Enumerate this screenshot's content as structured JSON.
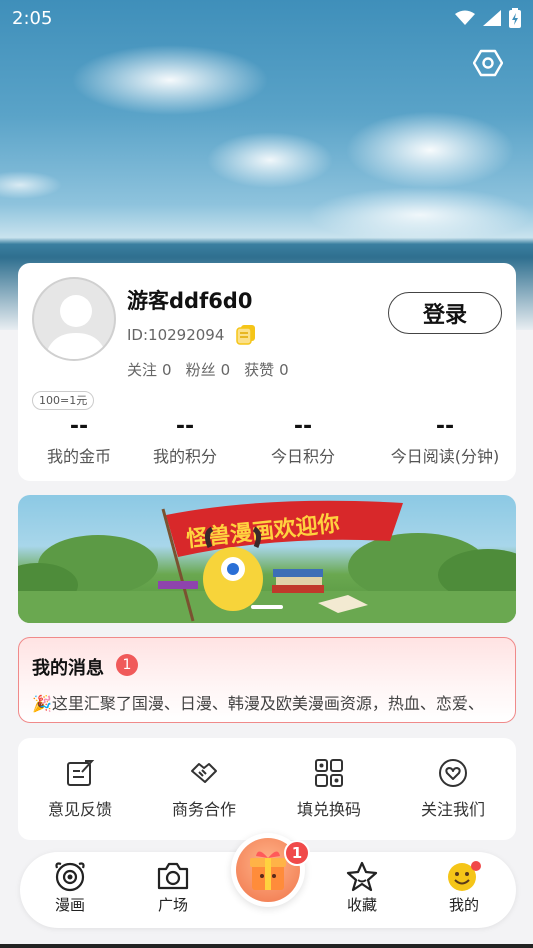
{
  "status_bar": {
    "time": "2:05"
  },
  "profile": {
    "username": "游客ddf6d0",
    "user_id": "ID:10292094",
    "follow_label": "关注",
    "follow_count": "0",
    "fans_label": "粉丝",
    "fans_count": "0",
    "likes_label": "获赞",
    "likes_count": "0",
    "login_label": "登录",
    "rate_badge": "100=1元"
  },
  "metrics": [
    {
      "value": "--",
      "label": "我的金币"
    },
    {
      "value": "--",
      "label": "我的积分"
    },
    {
      "value": "--",
      "label": "今日积分"
    },
    {
      "value": "--",
      "label": "今日阅读(分钟)"
    }
  ],
  "banner": {
    "flag_text": "怪兽漫画欢迎你"
  },
  "messages": {
    "title": "我的消息",
    "badge": "1",
    "emoji": "🎉",
    "text": "这里汇聚了国漫、日漫、韩漫及欧美漫画资源，热血、恋爱、"
  },
  "tools": [
    {
      "label": "意见反馈",
      "icon": "feedback-icon"
    },
    {
      "label": "商务合作",
      "icon": "handshake-icon"
    },
    {
      "label": "填兑换码",
      "icon": "redeem-code-icon"
    },
    {
      "label": "关注我们",
      "icon": "heart-icon"
    }
  ],
  "tabbar": {
    "items": [
      {
        "label": "漫画",
        "icon": "monster-eye-icon"
      },
      {
        "label": "广场",
        "icon": "camera-icon"
      },
      {
        "label": "收藏",
        "icon": "star-icon"
      },
      {
        "label": "我的",
        "icon": "smiley-icon"
      }
    ],
    "center_badge": "1"
  },
  "colors": {
    "accent_red": "#f05a5a",
    "coin_yellow": "#f5c518"
  }
}
